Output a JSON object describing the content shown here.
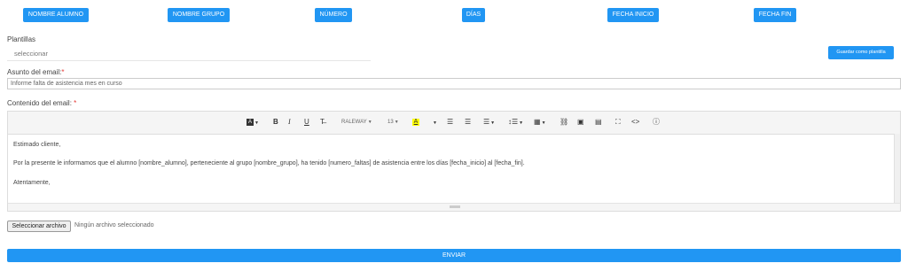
{
  "placeholders": [
    "NOMBRE ALUMNO",
    "NOMBRE GRUPO",
    "NÚMERO",
    "DÍAS",
    "FECHA INICIO",
    "FECHA FIN"
  ],
  "plantillas": {
    "label": "Plantillas",
    "value": "seleccionar",
    "save_label": "Guardar como plantilla"
  },
  "subject": {
    "label": "Asunto del email:",
    "required": "*",
    "value": "Informe falta de asistencia mes en curso"
  },
  "content": {
    "label": "Contenido del email:",
    "required": "*",
    "lines": [
      "Estimado cliente,",
      "Por la presente le informamos que el alumno [nombre_alumno], perteneciente al grupo [nombre_grupo], ha tenido [numero_faltas] de asistencia entre los días [fecha_inicio] al [fecha_fin].",
      "Atentamente,"
    ]
  },
  "toolbar": {
    "font_name": "RALEWAY",
    "font_size": "13",
    "highlight_color": "#ffff00"
  },
  "file": {
    "button_label": "Seleccionar archivo",
    "status": "Ningún archivo seleccionado"
  },
  "send_label": "ENVIAR"
}
